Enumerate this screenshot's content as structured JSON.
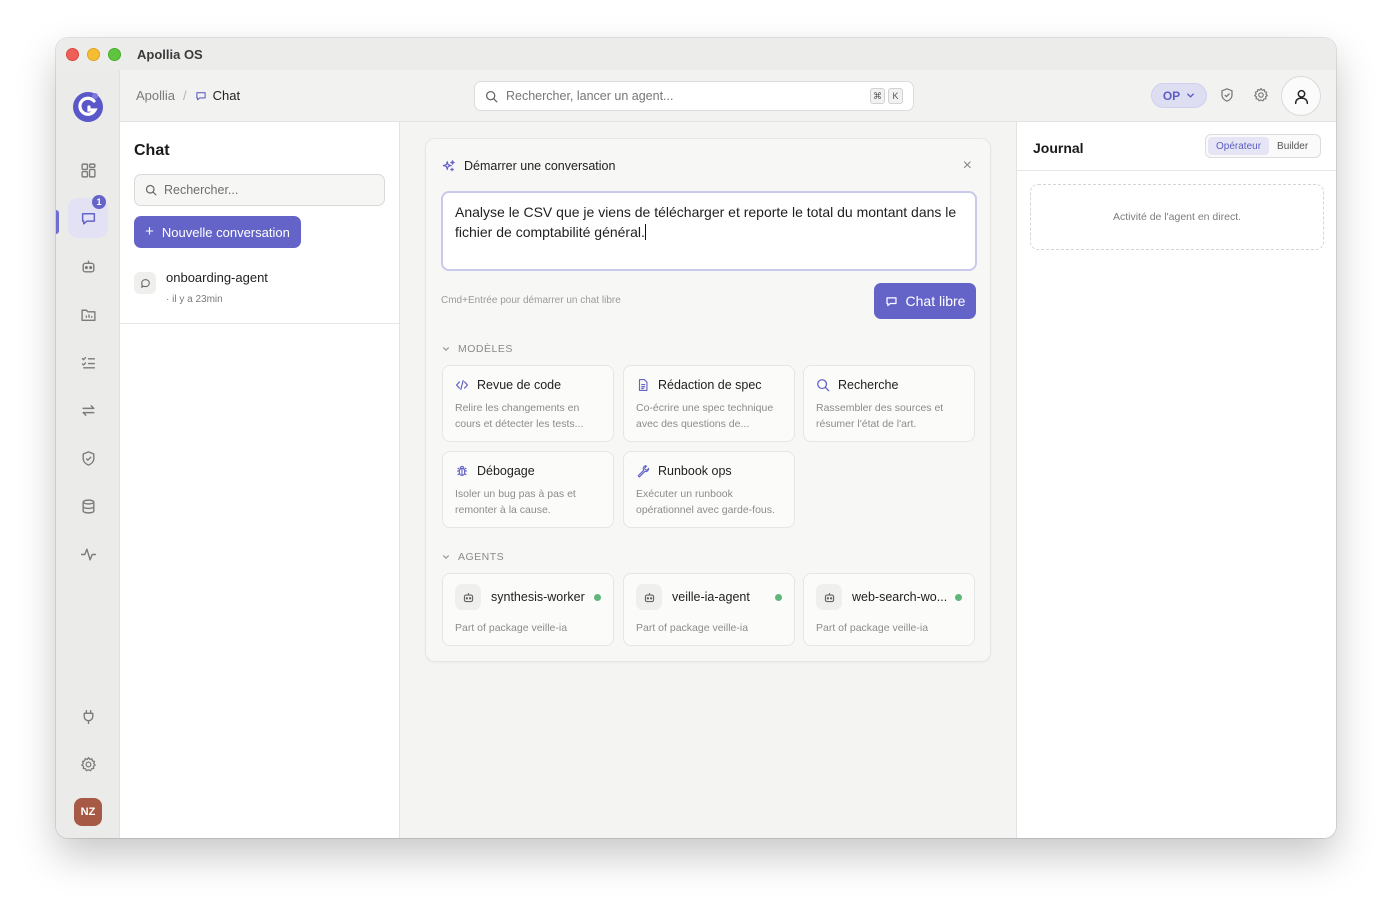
{
  "window": {
    "title": "Apollia OS"
  },
  "sidebar": {
    "chat_badge": "1",
    "avatar_initials": "NZ"
  },
  "topbar": {
    "breadcrumb_root": "Apollia",
    "breadcrumb_separator": "/",
    "breadcrumb_current": "Chat",
    "search_placeholder": "Rechercher, lancer un agent...",
    "shortcut_keys": [
      "⌘",
      "K"
    ],
    "operator_pill": "OP"
  },
  "chat_panel": {
    "title": "Chat",
    "search_placeholder": "Rechercher...",
    "new_conversation_label": "Nouvelle conversation",
    "conversations": [
      {
        "name": "onboarding-agent",
        "time": "· il y a 23min"
      }
    ]
  },
  "composer": {
    "header": "Démarrer une conversation",
    "prompt_text": "Analyse le CSV que je viens de télécharger et reporte le total du montant dans le fichier de comptabilité général.",
    "hint": "Cmd+Entrée pour démarrer un chat libre",
    "chat_libre_label": "Chat libre",
    "templates_label": "MODÈLES",
    "templates": [
      {
        "icon": "code-icon",
        "title": "Revue de code",
        "desc": "Relire les changements en cours et détecter les tests..."
      },
      {
        "icon": "document-icon",
        "title": "Rédaction de spec",
        "desc": "Co-écrire une spec technique avec des questions de..."
      },
      {
        "icon": "search-icon",
        "title": "Recherche",
        "desc": "Rassembler des sources et résumer l'état de l'art."
      },
      {
        "icon": "bug-icon",
        "title": "Débogage",
        "desc": "Isoler un bug pas à pas et remonter à la cause."
      },
      {
        "icon": "wrench-icon",
        "title": "Runbook ops",
        "desc": "Exécuter un runbook opérationnel avec garde-fous."
      }
    ],
    "agents_label": "AGENTS",
    "agents": [
      {
        "name": "synthesis-worker",
        "package": "Part of package veille-ia"
      },
      {
        "name": "veille-ia-agent",
        "package": "Part of package veille-ia"
      },
      {
        "name": "web-search-wo...",
        "package": "Part of package veille-ia"
      }
    ]
  },
  "journal": {
    "title": "Journal",
    "toggle_operator": "Opérateur",
    "toggle_builder": "Builder",
    "activity_text": "Activité de l'agent en direct."
  },
  "colors": {
    "accent": "#6464c8",
    "online": "#5fb77a",
    "avatar": "#a65a45"
  }
}
